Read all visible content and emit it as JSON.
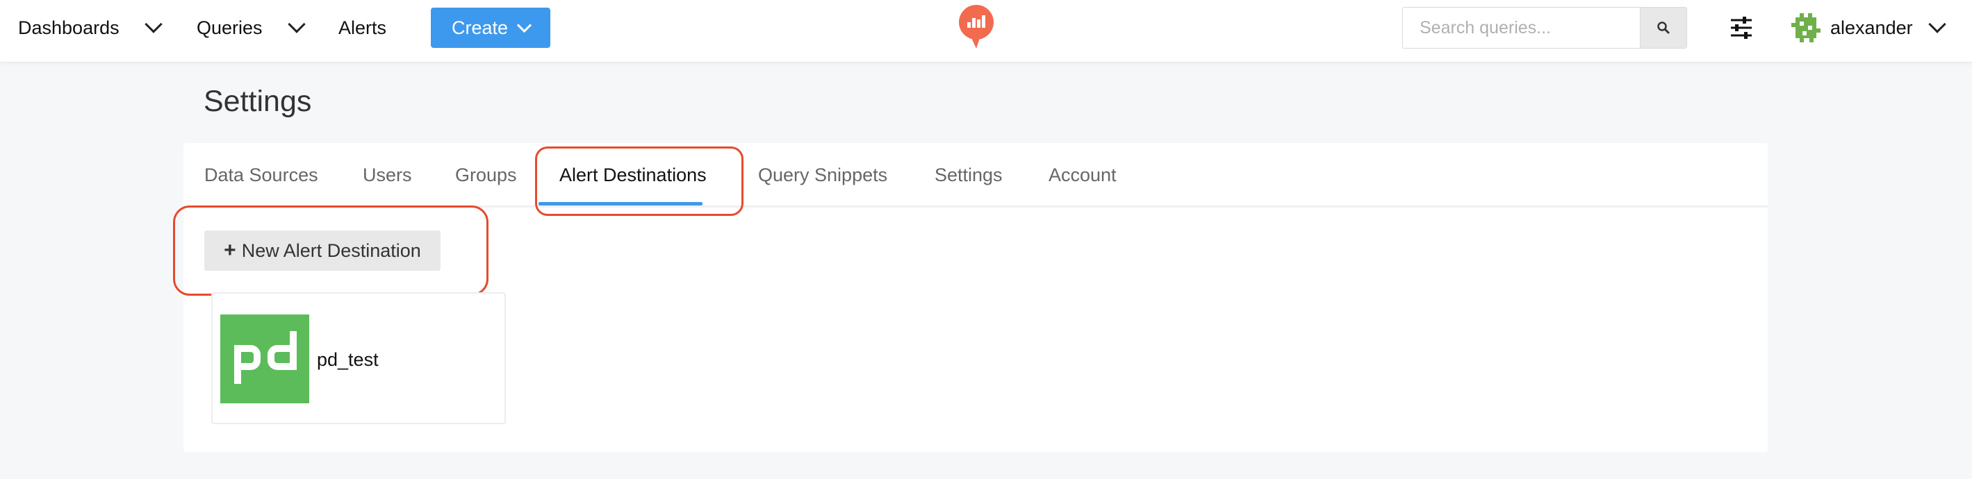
{
  "nav": {
    "dashboards": "Dashboards",
    "queries": "Queries",
    "alerts": "Alerts",
    "create": "Create"
  },
  "search": {
    "placeholder": "Search queries..."
  },
  "user": {
    "name": "alexander"
  },
  "page": {
    "title": "Settings"
  },
  "tabs": [
    {
      "label": "Data Sources"
    },
    {
      "label": "Users"
    },
    {
      "label": "Groups"
    },
    {
      "label": "Alert Destinations",
      "active": true
    },
    {
      "label": "Query Snippets"
    },
    {
      "label": "Settings"
    },
    {
      "label": "Account"
    }
  ],
  "actions": {
    "new_destination": "New Alert Destination"
  },
  "destinations": [
    {
      "name": "pd_test",
      "icon": "pagerduty-logo"
    }
  ],
  "colors": {
    "accent": "#3d99ed",
    "highlight": "#e64a2e",
    "brand_logo": "#f26b4f",
    "pagerduty": "#5cbc5a"
  }
}
